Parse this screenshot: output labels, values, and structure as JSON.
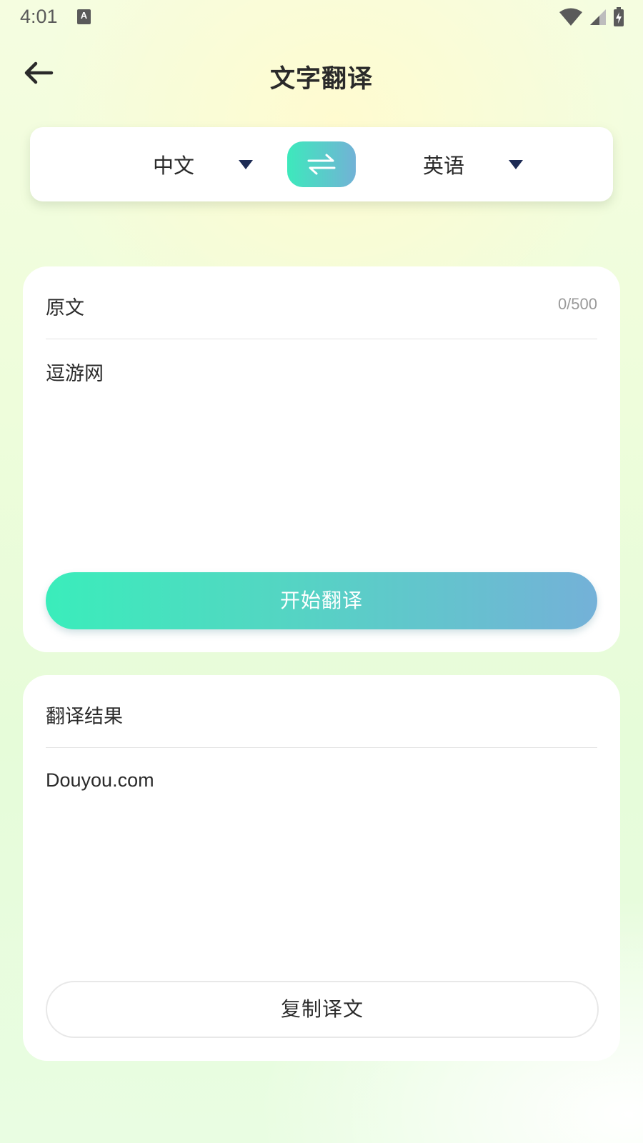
{
  "status_bar": {
    "time": "4:01",
    "notification_icon": "text-a-icon",
    "icons": [
      "wifi-icon",
      "signal-icon",
      "battery-charging-icon"
    ]
  },
  "header": {
    "title": "文字翻译",
    "back_icon": "arrow-left-icon"
  },
  "language_bar": {
    "source_language": "中文",
    "target_language": "英语",
    "swap_icon": "swap-arrows-icon",
    "dropdown_icon": "caret-down-icon"
  },
  "source_card": {
    "label": "原文",
    "char_count": "0/500",
    "text": "逗游网",
    "button_label": "开始翻译"
  },
  "result_card": {
    "label": "翻译结果",
    "text": "Douyou.com",
    "button_label": "复制译文"
  },
  "colors": {
    "gradient_start": "#3aedbb",
    "gradient_end": "#74b1d8",
    "dropdown_caret": "#1d2b55"
  }
}
